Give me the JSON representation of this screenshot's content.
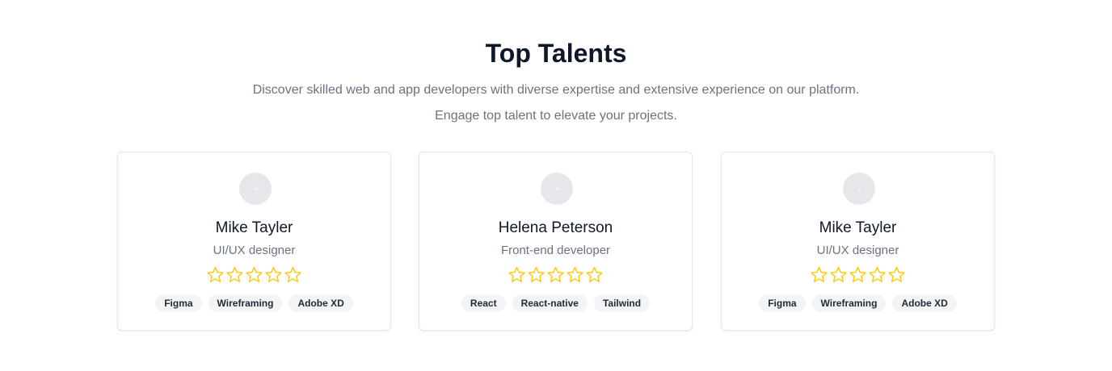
{
  "section": {
    "title": "Top Talents",
    "subtitle_line1": "Discover skilled web and app developers with diverse expertise and extensive experience on our platform.",
    "subtitle_line2": "Engage top talent to elevate your projects."
  },
  "colors": {
    "star": "#facc15",
    "title": "#0f172a",
    "muted": "#6b7280",
    "tag_bg": "#f3f4f6"
  },
  "talents": [
    {
      "name": "Mike Tayler",
      "role": "UI/UX designer",
      "rating": 0,
      "rating_max": 5,
      "tags": [
        "Figma",
        "Wireframing",
        "Adobe XD"
      ]
    },
    {
      "name": "Helena Peterson",
      "role": "Front-end developer",
      "rating": 0,
      "rating_max": 5,
      "tags": [
        "React",
        "React-native",
        "Tailwind"
      ]
    },
    {
      "name": "Mike Tayler",
      "role": "UI/UX designer",
      "rating": 0,
      "rating_max": 5,
      "tags": [
        "Figma",
        "Wireframing",
        "Adobe XD"
      ]
    }
  ]
}
